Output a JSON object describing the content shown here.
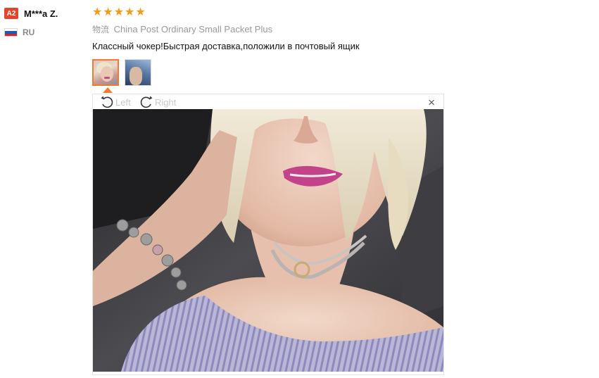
{
  "reviewer": {
    "level_badge": "A2",
    "name": "M***a Z.",
    "country_code": "RU",
    "flag_colors": [
      "#ffffff",
      "#1b5bb8",
      "#d8232a"
    ]
  },
  "rating": {
    "stars": 5,
    "star_glyph": "★",
    "color": "#f39c12"
  },
  "shipping": {
    "prefix": "物流",
    "method": "China Post Ordinary Small Packet Plus"
  },
  "review_text": "Классный чокер!Быстрая доставка,положили в почтовый ящик",
  "thumbnails": [
    {
      "id": "photo-1",
      "active": true
    },
    {
      "id": "photo-2",
      "active": false
    }
  ],
  "viewer": {
    "rotate_left_label": "Left",
    "rotate_right_label": "Right",
    "close_glyph": "×",
    "accent": "#f07b32"
  }
}
